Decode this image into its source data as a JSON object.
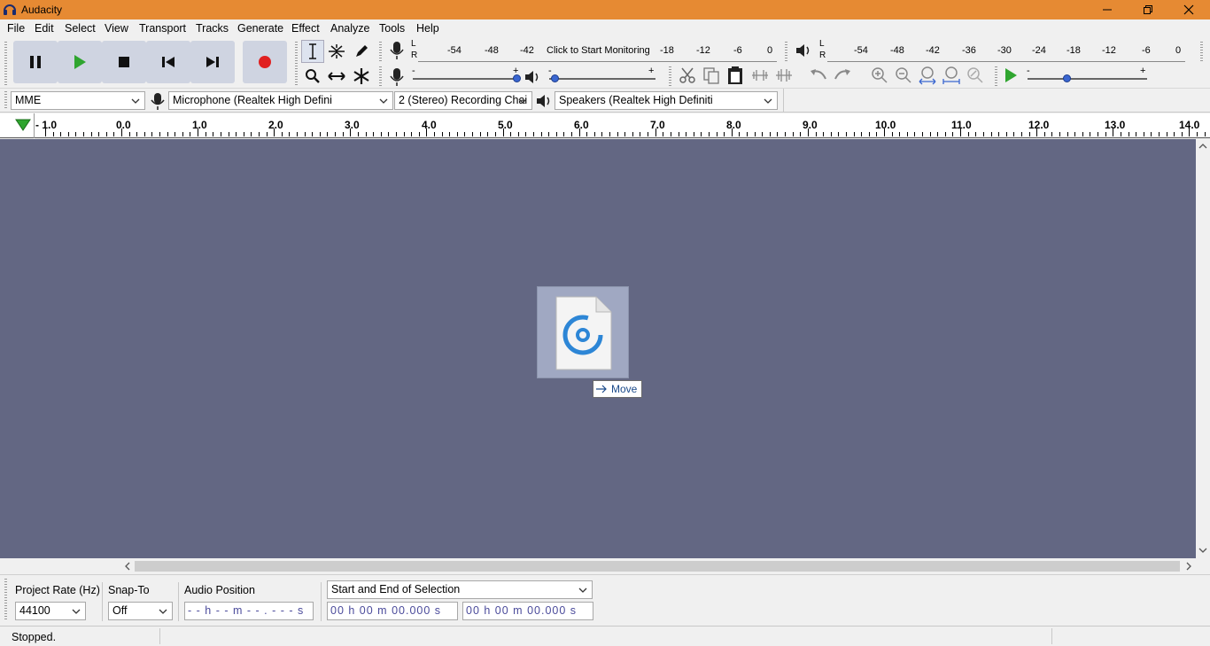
{
  "window": {
    "title": "Audacity"
  },
  "menu": [
    "File",
    "Edit",
    "Select",
    "View",
    "Transport",
    "Tracks",
    "Generate",
    "Effect",
    "Analyze",
    "Tools",
    "Help"
  ],
  "record_meter": {
    "channels": [
      "L",
      "R"
    ],
    "scale": [
      "-54",
      "-48",
      "-42",
      "-18",
      "-12",
      "-6",
      "0"
    ],
    "prompt": "Click to Start Monitoring"
  },
  "playback_meter": {
    "channels": [
      "L",
      "R"
    ],
    "scale": [
      "-54",
      "-48",
      "-42",
      "-36",
      "-30",
      "-24",
      "-18",
      "-12",
      "-6",
      "0"
    ]
  },
  "mixer": {
    "minus": "-",
    "plus": "+"
  },
  "play_at_speed": {
    "minus": "-",
    "plus": "+"
  },
  "devices": {
    "host": "MME",
    "recording_device": "Microphone (Realtek High Defini",
    "recording_channels": "2 (Stereo) Recording Chai",
    "playback_device": "Speakers (Realtek High Definiti"
  },
  "ruler": {
    "labels": [
      "- 1.0",
      "0.0",
      "1.0",
      "2.0",
      "3.0",
      "4.0",
      "5.0",
      "6.0",
      "7.0",
      "8.0",
      "9.0",
      "10.0",
      "11.0",
      "12.0",
      "13.0",
      "14.0"
    ]
  },
  "drag": {
    "tooltip": "Move"
  },
  "selection_toolbar": {
    "project_rate_label": "Project Rate (Hz)",
    "project_rate_value": "44100",
    "snap_to_label": "Snap-To",
    "snap_to_value": "Off",
    "audio_position_label": "Audio Position",
    "audio_position_value": "- - h - - m - - . - - - s",
    "selection_mode": "Start and End of Selection",
    "selection_start": "00 h 00 m 00.000 s",
    "selection_end": "00 h 00 m 00.000 s"
  },
  "status": {
    "text": "Stopped."
  },
  "colors": {
    "titlebar": "#e68a33",
    "track_area": "#636783",
    "record_red": "#e02020",
    "play_green": "#2fa52f",
    "meter_blue": "#3a66d0"
  }
}
